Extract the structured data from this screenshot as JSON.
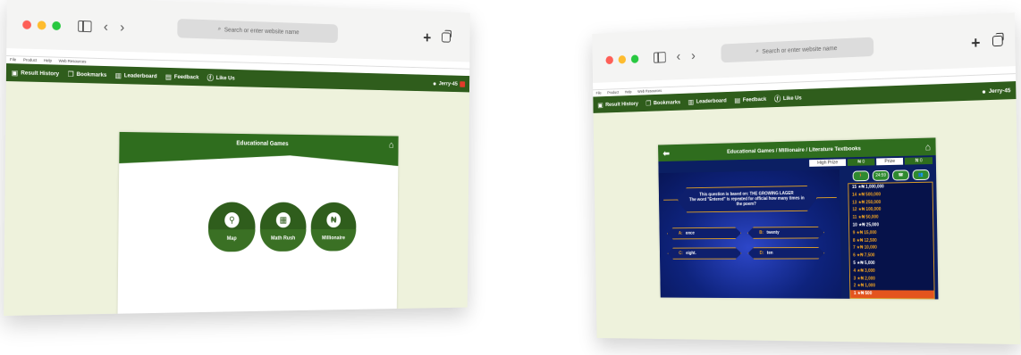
{
  "browser": {
    "url_placeholder": "Search or enter website name",
    "back_glyph": "‹",
    "forward_glyph": "›",
    "new_tab_glyph": "+",
    "search_glyph": "⌕"
  },
  "menu": [
    "File",
    "Product",
    "Help",
    "Web Resources"
  ],
  "nav_left": [
    "Result History",
    "Bookmarks",
    "Leaderboard",
    "Feedback",
    "Like Us"
  ],
  "nav_right": [
    "Bookmarks",
    "Leaderboard",
    "Feedback",
    "Like Us"
  ],
  "nav_right_first": "Result History",
  "user": "Jerry-45",
  "left_panel": {
    "title": "Educational Games",
    "games": [
      "Map",
      "Math Rush",
      "Millionaire"
    ]
  },
  "right_panel": {
    "title": "Educational Games / Millionaire / Literature Textbooks",
    "high_prize_label": "High Prize",
    "high_prize_value": "₦ 0",
    "prize_label": "Prize",
    "prize_value": "₦ 0",
    "timer": "24:59",
    "question_line1": "This question is based on: THE GROWING LAGER",
    "question_line2": "The word \"Entered\" is repeated for official how many times in the poem?",
    "answers": [
      {
        "letter": "A:",
        "text": "once"
      },
      {
        "letter": "B:",
        "text": "twenty"
      },
      {
        "letter": "C:",
        "text": "eight."
      },
      {
        "letter": "D:",
        "text": "ten"
      }
    ],
    "ladder": [
      "15 ★₦ 1,000,000",
      "14 ★₦ 500,000",
      "13 ★₦ 250,000",
      "12 ★₦ 100,000",
      "11 ★₦ 50,000",
      "10 ★₦ 25,000",
      "9  ★₦ 15,000",
      "8  ★₦ 12,500",
      "7  ★₦ 10,000",
      "6  ★₦ 7,500",
      "5  ★₦ 5,000",
      "4  ★₦ 3,000",
      "3  ★₦ 2,000",
      "2  ★₦ 1,000",
      "1  ★₦ 500"
    ]
  },
  "colors": {
    "nav_green": "#2f5d1c",
    "page_bg": "#eef2dc",
    "quiz_blue": "#0b1f63",
    "gold": "#d89b2a",
    "current_rung": "#e4541e"
  }
}
